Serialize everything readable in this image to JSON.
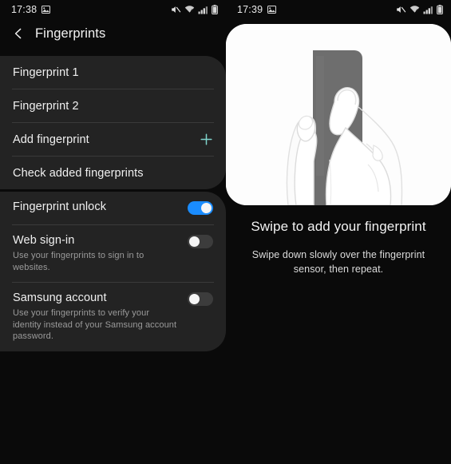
{
  "left": {
    "status": {
      "time": "17:38",
      "icons": [
        "image-icon",
        "mute-icon",
        "wifi-icon",
        "signal-icon",
        "battery-icon"
      ]
    },
    "titlebar": {
      "back_icon": "chevron-left-icon",
      "title": "Fingerprints"
    },
    "fingerprint_list": [
      {
        "label": "Fingerprint 1",
        "trailing_icon": null
      },
      {
        "label": "Fingerprint 2",
        "trailing_icon": null
      },
      {
        "label": "Add fingerprint",
        "trailing_icon": "plus-icon"
      },
      {
        "label": "Check added fingerprints",
        "trailing_icon": null
      }
    ],
    "switches": [
      {
        "title": "Fingerprint unlock",
        "subtitle": "",
        "state": "on"
      },
      {
        "title": "Web sign-in",
        "subtitle": "Use your fingerprints to sign in to websites.",
        "state": "off"
      },
      {
        "title": "Samsung account",
        "subtitle": "Use your fingerprints to verify your identity instead of your Samsung account password.",
        "state": "off"
      }
    ]
  },
  "right": {
    "status": {
      "time": "17:39",
      "icons": [
        "image-icon",
        "mute-icon",
        "wifi-icon",
        "signal-icon",
        "battery-icon"
      ]
    },
    "illustration": "hand-holding-phone-fingerprint-illustration",
    "heading": "Swipe to add your fingerprint",
    "subtitle": "Swipe down slowly over the fingerprint sensor, then repeat."
  },
  "colors": {
    "accent_toggle_on": "#1a8cff",
    "accent_plus": "#7fd4cc",
    "card_background": "#232323",
    "screen_background": "#0a0a0a"
  }
}
